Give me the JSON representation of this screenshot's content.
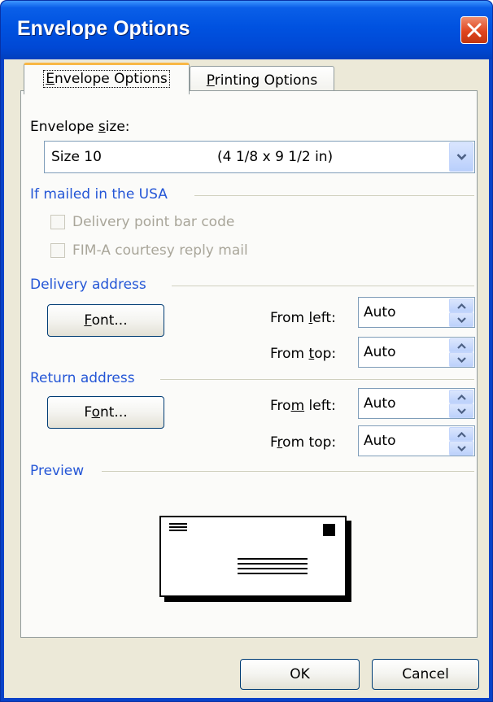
{
  "dialog": {
    "title": "Envelope Options"
  },
  "tabs": [
    {
      "label_pre": "",
      "label_ul": "E",
      "label_post": "nvelope Options"
    },
    {
      "label_pre": "",
      "label_ul": "P",
      "label_post": "rinting Options"
    }
  ],
  "envelope_size": {
    "label_pre": "Envelope ",
    "label_ul": "s",
    "label_post": "ize:",
    "selected_name": "Size 10",
    "selected_dims": "(4 1/8 x 9 1/2 in)"
  },
  "usa_group": {
    "title": "If mailed in the USA",
    "checkbox1": "Delivery point bar code",
    "checkbox2": "FIM-A courtesy reply mail"
  },
  "delivery": {
    "title": "Delivery address",
    "font_pre": "",
    "font_ul": "F",
    "font_post": "ont...",
    "from_left_pre": "From ",
    "from_left_ul": "l",
    "from_left_post": "eft:",
    "from_left_value": "Auto",
    "from_top_pre": "From ",
    "from_top_ul": "t",
    "from_top_post": "op:",
    "from_top_value": "Auto"
  },
  "return": {
    "title": "Return address",
    "font_pre": "F",
    "font_ul": "o",
    "font_post": "nt...",
    "from_left_pre": "Fro",
    "from_left_ul": "m",
    "from_left_post": " left:",
    "from_left_value": "Auto",
    "from_top_pre": "F",
    "from_top_ul": "r",
    "from_top_post": "om top:",
    "from_top_value": "Auto"
  },
  "preview": {
    "title": "Preview"
  },
  "buttons": {
    "ok": "OK",
    "cancel": "Cancel"
  },
  "icons": {
    "close": "close-icon",
    "dropdown": "chevron-down-icon",
    "spin_up": "spin-up-icon",
    "spin_down": "spin-down-icon"
  },
  "colors": {
    "titlebar": "#0054e3",
    "group_title": "#2456d6",
    "close_button": "#e0451e",
    "tab_highlight": "#f8b745"
  }
}
